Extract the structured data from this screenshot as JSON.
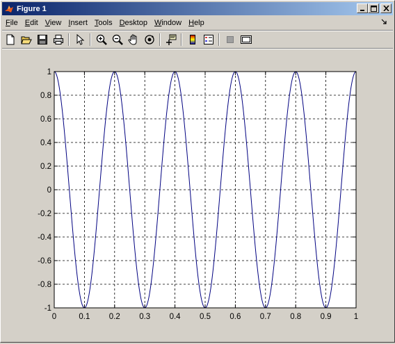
{
  "window": {
    "title": "Figure 1"
  },
  "menu": {
    "items": [
      {
        "label": "File",
        "key": "F"
      },
      {
        "label": "Edit",
        "key": "E"
      },
      {
        "label": "View",
        "key": "V"
      },
      {
        "label": "Insert",
        "key": "I"
      },
      {
        "label": "Tools",
        "key": "T"
      },
      {
        "label": "Desktop",
        "key": "D"
      },
      {
        "label": "Window",
        "key": "W"
      },
      {
        "label": "Help",
        "key": "H"
      }
    ]
  },
  "toolbar": {
    "buttons": [
      "new-figure-icon",
      "open-file-icon",
      "save-icon",
      "print-icon",
      "edit-plot-arrow-icon",
      "zoom-in-icon",
      "zoom-out-icon",
      "pan-hand-icon",
      "rotate-3d-icon",
      "data-cursor-icon",
      "colorbar-icon",
      "legend-icon",
      "hide-plot-tools-icon",
      "show-plot-tools-icon"
    ]
  },
  "chart_data": {
    "type": "line",
    "title": "",
    "xlabel": "",
    "ylabel": "",
    "function": "cos(2*pi*5*x)",
    "xlim": [
      0,
      1
    ],
    "ylim": [
      -1,
      1
    ],
    "xticks": [
      "0",
      "0.1",
      "0.2",
      "0.3",
      "0.4",
      "0.5",
      "0.6",
      "0.7",
      "0.8",
      "0.9",
      "1"
    ],
    "yticks": [
      "1",
      "0.8",
      "0.6",
      "0.4",
      "0.2",
      "0",
      "-0.2",
      "-0.4",
      "-0.6",
      "-0.8",
      "-1"
    ],
    "grid": true,
    "series": [
      {
        "color": "#000080",
        "x": [
          0,
          0.1,
          0.2,
          0.3,
          0.4,
          0.5,
          0.6,
          0.7,
          0.8,
          0.9,
          1
        ],
        "y": [
          1,
          -1,
          1,
          -1,
          1,
          -1,
          1,
          -1,
          1,
          -1,
          1
        ]
      }
    ]
  },
  "colors": {
    "line": "#000080",
    "titlebar_start": "#0a246a",
    "titlebar_end": "#a6caf0"
  }
}
